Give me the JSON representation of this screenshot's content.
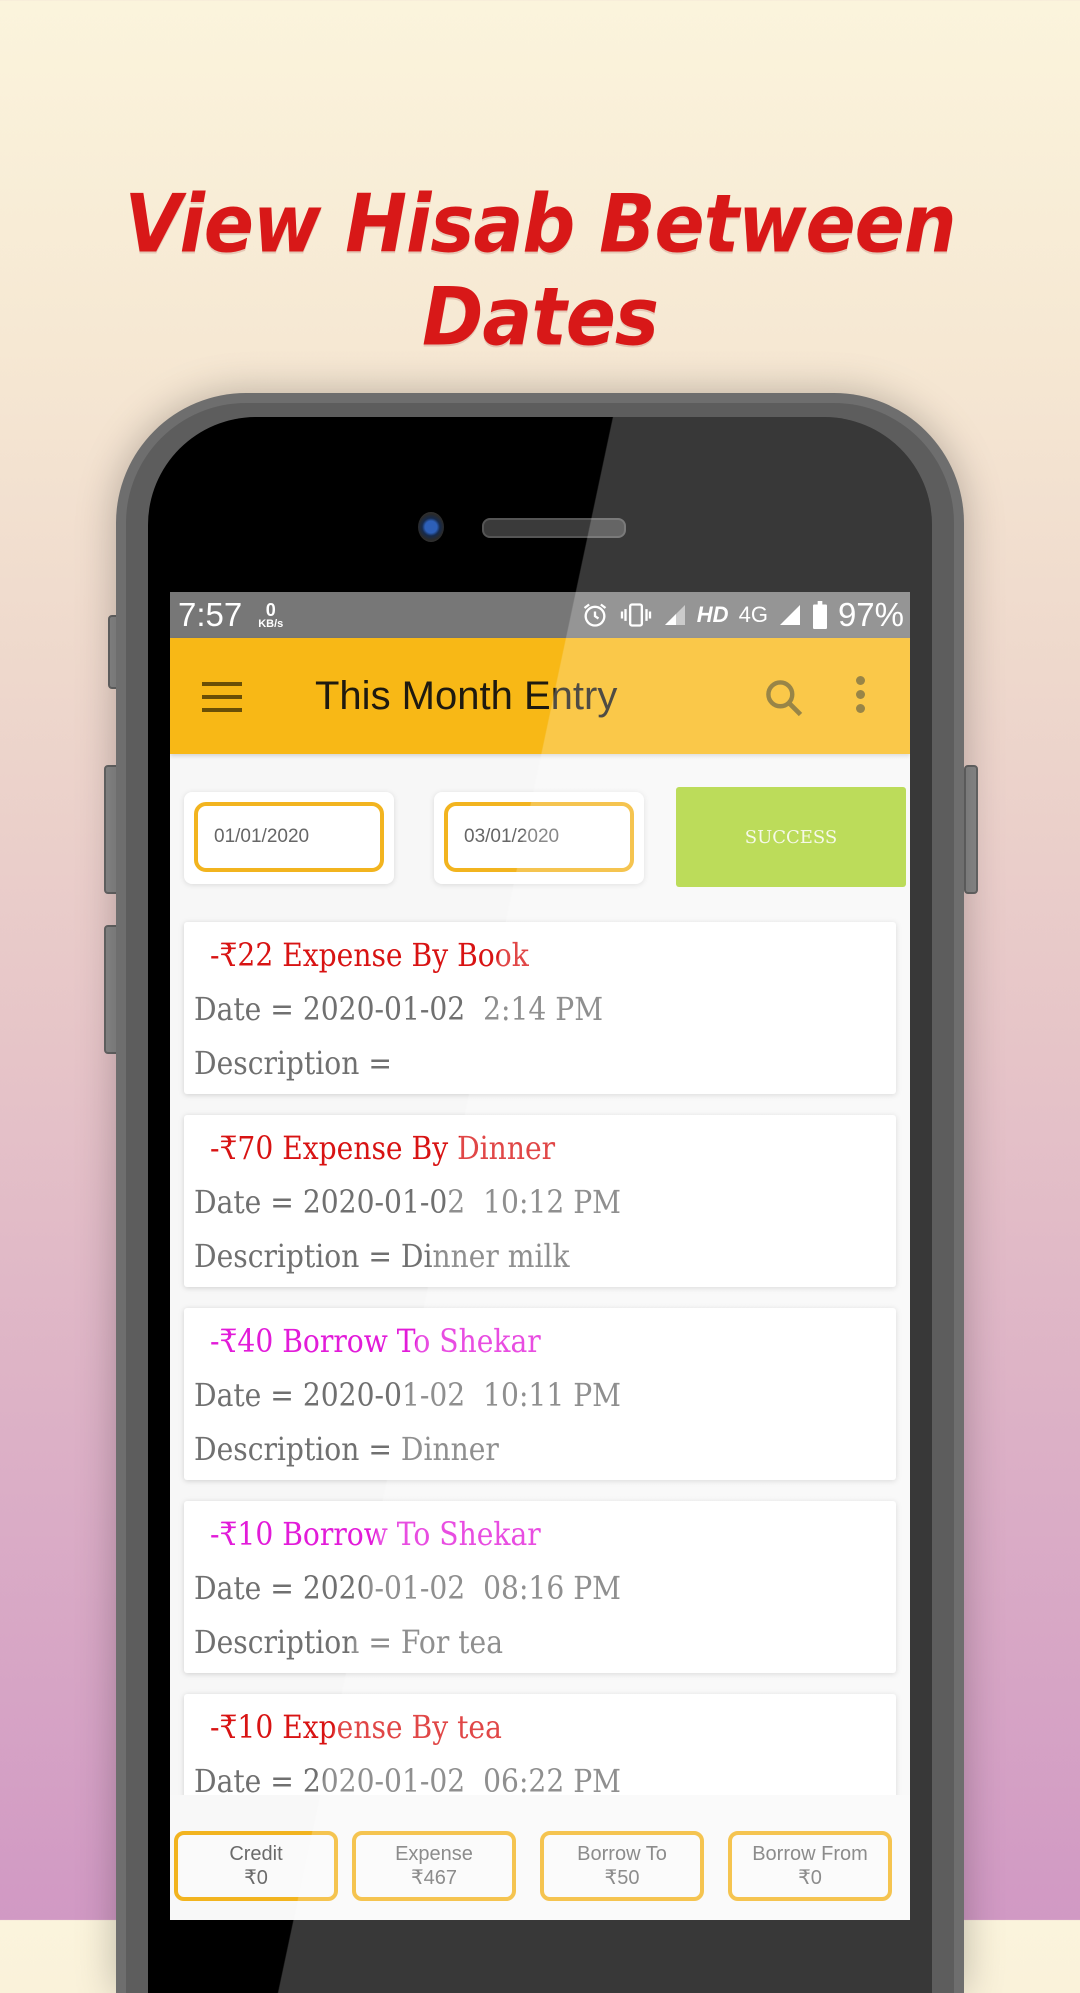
{
  "promo": {
    "headline": "View Hisab Between Dates"
  },
  "status_bar": {
    "time": "7:57",
    "speed_value": "0",
    "speed_unit": "KB/s",
    "hd": "HD",
    "network": "4G",
    "battery": "97%",
    "icons": [
      "alarm-icon",
      "vibrate-icon",
      "signal-icon",
      "signal-icon",
      "battery-icon"
    ]
  },
  "app_bar": {
    "title": "This Month Entry",
    "menu_icon": "hamburger-icon",
    "search_icon": "search-icon",
    "more_icon": "more-vert-icon"
  },
  "filter": {
    "from_date": "01/01/2020",
    "to_date": "03/01/2020",
    "submit_label": "SUCCESS"
  },
  "colors": {
    "accent": "#f8b816",
    "success": "#a9d22c",
    "expense": "#d81313",
    "borrow": "#e21bd9",
    "muted_text": "#707070"
  },
  "entries": [
    {
      "title": "-₹22 Expense By Book",
      "type": "expense",
      "date": "Date = 2020-01-02  2:14 PM",
      "description": "Description = "
    },
    {
      "title": "-₹70 Expense By Dinner",
      "type": "expense",
      "date": "Date = 2020-01-02  10:12 PM",
      "description": "Description = Dinner milk"
    },
    {
      "title": "-₹40 Borrow To Shekar",
      "type": "borrow",
      "date": "Date = 2020-01-02  10:11 PM",
      "description": "Description = Dinner"
    },
    {
      "title": "-₹10 Borrow To Shekar",
      "type": "borrow",
      "date": "Date = 2020-01-02  08:16 PM",
      "description": "Description = For tea"
    },
    {
      "title": "-₹10 Expense By tea",
      "type": "expense",
      "date": "Date = 2020-01-02  06:22 PM",
      "description": ""
    }
  ],
  "summary": [
    {
      "label": "Credit",
      "amount": "₹0"
    },
    {
      "label": "Expense",
      "amount": "₹467"
    },
    {
      "label": "Borrow To",
      "amount": "₹50"
    },
    {
      "label": "Borrow From",
      "amount": "₹0"
    }
  ]
}
